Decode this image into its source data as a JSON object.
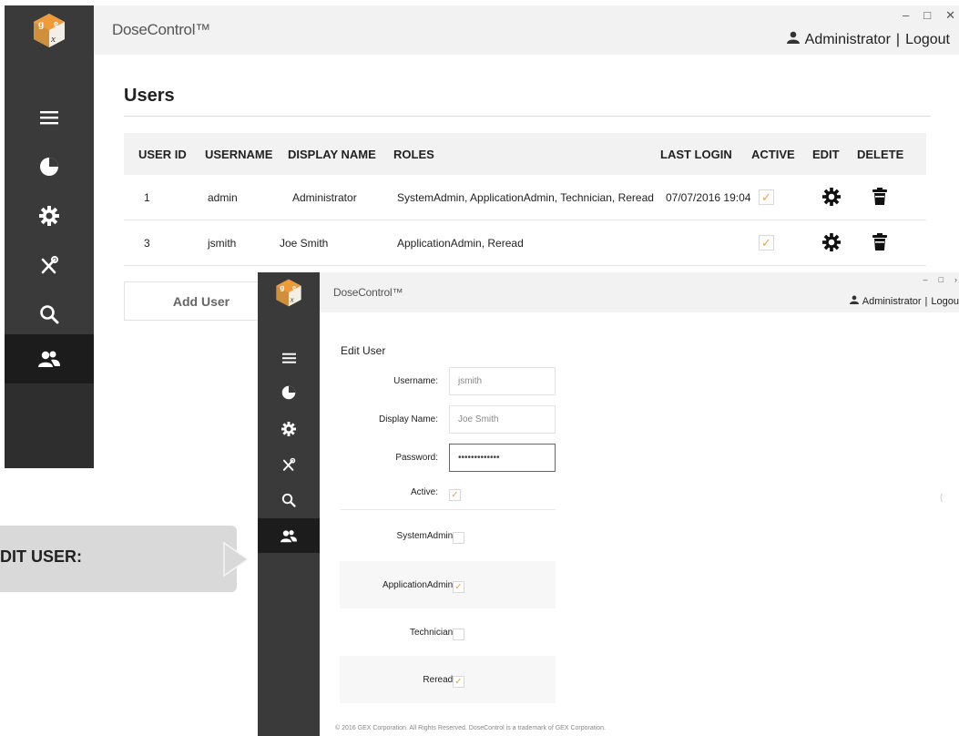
{
  "colors": {
    "sidebar": "#3a3a3a",
    "sidebar_active": "#1c1c1c",
    "header": "#f2f2f2",
    "accent_check": "#f0a430",
    "callout": "#d9d9d9"
  },
  "window1": {
    "app_title": "DoseControl™",
    "user_name": "Administrator",
    "separator": "|",
    "logout": "Logout",
    "window_controls": {
      "minimize": "–",
      "maximize": "□",
      "close": "✕"
    },
    "sidebar_items": [
      "menu-icon",
      "dashboard-icon",
      "settings-icon",
      "tools-icon",
      "search-icon",
      "users-icon"
    ],
    "page_title": "Users",
    "table": {
      "headers": [
        "USER ID",
        "USERNAME",
        "DISPLAY NAME",
        "ROLES",
        "LAST LOGIN",
        "ACTIVE",
        "EDIT",
        "DELETE"
      ],
      "rows": [
        {
          "user_id": "1",
          "username": "admin",
          "display_name": "Administrator",
          "roles": "SystemAdmin, ApplicationAdmin, Technician, Reread",
          "last_login": "07/07/2016 19:04",
          "active": true,
          "active_mark": "✓"
        },
        {
          "user_id": "3",
          "username": "jsmith",
          "display_name": "Joe Smith",
          "roles": "ApplicationAdmin, Reread",
          "last_login": "",
          "active": true,
          "active_mark": "✓"
        }
      ]
    },
    "add_user_label": "Add User"
  },
  "callout": {
    "text": "DIT USER:"
  },
  "window2": {
    "app_title": "DoseControl™",
    "user_name": "Administrator",
    "separator": "|",
    "logout": "Logou",
    "window_controls": {
      "minimize": "–",
      "maximize": "□",
      "close": "›"
    },
    "edit_title": "Edit User",
    "form": {
      "username_label": "Username:",
      "username_value": "jsmith",
      "display_name_label": "Display Name:",
      "display_name_value": "Joe Smith",
      "password_label": "Password:",
      "password_value": "•••••••••••••",
      "active_label": "Active:",
      "active_checked": true,
      "check_mark": "✓"
    },
    "roles": [
      {
        "label": "SystemAdmin:",
        "checked": false,
        "mark": ""
      },
      {
        "label": "ApplicationAdmin:",
        "checked": true,
        "mark": "✓"
      },
      {
        "label": "Technician:",
        "checked": false,
        "mark": ""
      },
      {
        "label": "Reread:",
        "checked": true,
        "mark": "✓"
      }
    ],
    "footer": "© 2016 GEX Corporation. All Rights Reserved. DoseControl is a trademark of GEX Corporation.",
    "stray_char": "("
  }
}
